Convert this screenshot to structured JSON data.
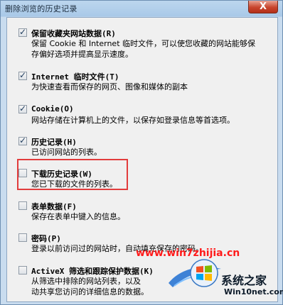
{
  "window": {
    "title": "删除浏览的历史记录",
    "close_label": "X"
  },
  "options": [
    {
      "key": "favorites",
      "checked": true,
      "title": "保留收藏夹网站数据(R)",
      "desc": [
        "保留 Cookie 和 Internet 临时文件，可以使您收藏的网站能够保",
        "存偏好选项并提高显示速度。"
      ]
    },
    {
      "key": "temp-files",
      "checked": true,
      "title": "Internet 临时文件(T)",
      "desc": [
        "为快速查看而保存的网页、图像和媒体的副本"
      ]
    },
    {
      "key": "cookies",
      "checked": true,
      "title": "Cookie(O)",
      "desc": [
        "网站存储在计算机上的文件，以保存如登录信息等首选项。"
      ]
    },
    {
      "key": "history",
      "checked": true,
      "title": "历史记录(H)",
      "desc": [
        "已访问网站的列表。"
      ]
    },
    {
      "key": "download-history",
      "checked": false,
      "title": "下载历史记录(W)",
      "desc": [
        "您已下载的文件的列表。"
      ]
    },
    {
      "key": "form-data",
      "checked": false,
      "title": "表单数据(F)",
      "desc": [
        "保存在表单中键入的信息。"
      ]
    },
    {
      "key": "passwords",
      "checked": false,
      "title": "密码(P)",
      "desc": [
        "登录以前访问过的网站时，自动填充保存的密码。"
      ]
    },
    {
      "key": "activex",
      "checked": false,
      "title": "ActiveX 筛选和跟踪保护数据(K)",
      "desc": [
        "从筛选中排除的网站列表，以及",
        "动共享您访问的详细信息的数据。"
      ]
    }
  ],
  "watermark": {
    "url": "www.win7zhijia.cn",
    "logo_title": "系统之家",
    "logo_sub": "Win10net.com"
  },
  "colors": {
    "highlight": "#e23c3c",
    "watermark": "#ff1a1a"
  }
}
